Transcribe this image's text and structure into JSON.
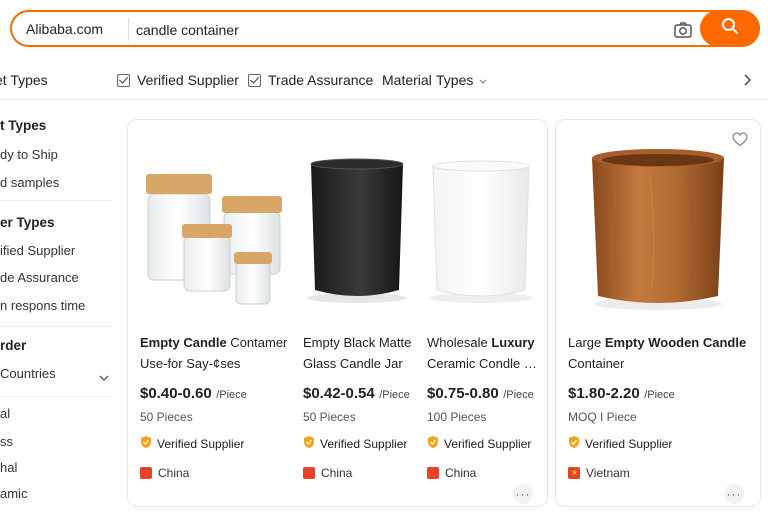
{
  "search": {
    "brand": "Alibaba.com",
    "query": "candle container"
  },
  "filters": {
    "left_cut": "et Types",
    "verified_supplier": "Verified Supplier",
    "trade_assurance": "Trade Assurance",
    "material": "Material",
    "types": "Types"
  },
  "sidebar": {
    "items": [
      "t Types",
      "dy to Ship",
      "d samples",
      "er Types",
      "ified Supplier",
      "de Assurance",
      "n respons time",
      "rder",
      "Countries",
      "al",
      "ss",
      "hal",
      "amic"
    ]
  },
  "products": [
    {
      "title_line1_bold": "Empty Candle",
      "title_line1_rest": " Contamer",
      "title_line2": "Use-for Say-¢ses",
      "price": "$0.40-0.60",
      "unit": "/Piece",
      "moq": "50 Pieces",
      "verified": "Verified Supplier",
      "country": "China"
    },
    {
      "title_line1_bold": "",
      "title_line1_rest": "Empty Black Matte",
      "title_line2": "Glass Candle Jar",
      "price": "$0.42-0.54",
      "unit": "/Piece",
      "moq": "50 Pieces",
      "verified": "Verified Supplier",
      "country": "China"
    },
    {
      "title_line1_bold": "",
      "title_line1_rest": "Wholesale ",
      "title_line1_bold2": "Luxury",
      "title_line2": "Ceramic Condle C...",
      "price": "$0.75-0.80",
      "unit": "/Piece",
      "moq": "100 Pieces",
      "verified": "Verified Supplier",
      "country": "China"
    },
    {
      "title_line1_rest": "Large ",
      "title_line1_bold": "Empty Wooden Candle",
      "title_line2": "Container",
      "price": "$1.80-2.20",
      "unit": "/Piece",
      "moq": "MOQ I Piece",
      "verified": "Verified Supplier",
      "country": "Vietnam"
    }
  ],
  "colors": {
    "accent": "#ff6a00",
    "badge": "#f7a21b",
    "flag_china": "#e8412c",
    "flag_vietnam": "#e8412c"
  }
}
